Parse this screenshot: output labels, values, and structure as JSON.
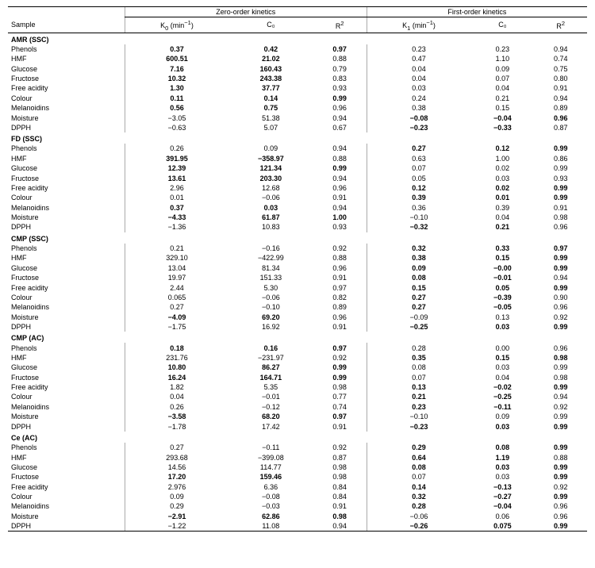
{
  "table": {
    "group1_label": "Zero-order kinetics",
    "group2_label": "First-order kinetics",
    "col_sample": "Sample",
    "col_k0": "K₀ (min⁻¹)",
    "col_c0_1": "C₀",
    "col_r2_1": "R²",
    "col_k1": "K₁ (min⁻¹)",
    "col_c0_2": "C₀",
    "col_r2_2": "R²",
    "sections": [
      {
        "section": "AMR (SSC)",
        "rows": [
          {
            "sample": "Phenols",
            "k0": "0.37",
            "c0_1": "0.42",
            "r2_1": "0.97",
            "k1": "0.23",
            "c0_2": "0.23",
            "r2_2": "0.94",
            "bold_k0": true,
            "bold_c0_1": true,
            "bold_r2_1": true
          },
          {
            "sample": "HMF",
            "k0": "600.51",
            "c0_1": "21.02",
            "r2_1": "0.88",
            "k1": "0.47",
            "c0_2": "1.10",
            "r2_2": "0.74",
            "bold_k0": true,
            "bold_c0_1": true
          },
          {
            "sample": "Glucose",
            "k0": "7.16",
            "c0_1": "160.43",
            "r2_1": "0.79",
            "k1": "0.04",
            "c0_2": "0.09",
            "r2_2": "0.75",
            "bold_k0": true,
            "bold_c0_1": true
          },
          {
            "sample": "Fructose",
            "k0": "10.32",
            "c0_1": "243.38",
            "r2_1": "0.83",
            "k1": "0.04",
            "c0_2": "0.07",
            "r2_2": "0.80",
            "bold_k0": true,
            "bold_c0_1": true
          },
          {
            "sample": "Free acidity",
            "k0": "1.30",
            "c0_1": "37.77",
            "r2_1": "0.93",
            "k1": "0.03",
            "c0_2": "0.04",
            "r2_2": "0.91",
            "bold_k0": true,
            "bold_c0_1": true
          },
          {
            "sample": "Colour",
            "k0": "0.11",
            "c0_1": "0.14",
            "r2_1": "0.99",
            "k1": "0.24",
            "c0_2": "0.21",
            "r2_2": "0.94",
            "bold_k0": true,
            "bold_c0_1": true,
            "bold_r2_1": true
          },
          {
            "sample": "Melanoidins",
            "k0": "0.56",
            "c0_1": "0.75",
            "r2_1": "0.96",
            "k1": "0.38",
            "c0_2": "0.15",
            "r2_2": "0.89",
            "bold_k0": true,
            "bold_c0_1": true
          },
          {
            "sample": "Moisture",
            "k0": "−3.05",
            "c0_1": "51.38",
            "r2_1": "0.94",
            "k1": "−0.08",
            "c0_2": "−0.04",
            "r2_2": "0.96",
            "bold_k1": true,
            "bold_c0_2": true,
            "bold_r2_2": true
          },
          {
            "sample": "DPPH",
            "k0": "−0.63",
            "c0_1": "5.07",
            "r2_1": "0.67",
            "k1": "−0.23",
            "c0_2": "−0.33",
            "r2_2": "0.87",
            "bold_k1": true,
            "bold_c0_2": true
          }
        ]
      },
      {
        "section": "FD (SSC)",
        "rows": [
          {
            "sample": "Phenols",
            "k0": "0.26",
            "c0_1": "0.09",
            "r2_1": "0.94",
            "k1": "0.27",
            "c0_2": "0.12",
            "r2_2": "0.99",
            "bold_k1": true,
            "bold_c0_2": true,
            "bold_r2_2": true
          },
          {
            "sample": "HMF",
            "k0": "391.95",
            "c0_1": "−358.97",
            "r2_1": "0.88",
            "k1": "0.63",
            "c0_2": "1.00",
            "r2_2": "0.86",
            "bold_k0": true,
            "bold_c0_1": true
          },
          {
            "sample": "Glucose",
            "k0": "12.39",
            "c0_1": "121.34",
            "r2_1": "0.99",
            "k1": "0.07",
            "c0_2": "0.02",
            "r2_2": "0.99",
            "bold_k0": true,
            "bold_c0_1": true,
            "bold_r2_1": true
          },
          {
            "sample": "Fructose",
            "k0": "13.61",
            "c0_1": "203.30",
            "r2_1": "0.94",
            "k1": "0.05",
            "c0_2": "0.03",
            "r2_2": "0.93",
            "bold_k0": true,
            "bold_c0_1": true
          },
          {
            "sample": "Free acidity",
            "k0": "2.96",
            "c0_1": "12.68",
            "r2_1": "0.96",
            "k1": "0.12",
            "c0_2": "0.02",
            "r2_2": "0.99",
            "bold_k1": true,
            "bold_c0_2": true,
            "bold_r2_2": true
          },
          {
            "sample": "Colour",
            "k0": "0.01",
            "c0_1": "−0.06",
            "r2_1": "0.91",
            "k1": "0.39",
            "c0_2": "0.01",
            "r2_2": "0.99",
            "bold_k1": true,
            "bold_c0_2": true,
            "bold_r2_2": true
          },
          {
            "sample": "Melanoidins",
            "k0": "0.37",
            "c0_1": "0.03",
            "r2_1": "0.94",
            "k1": "0.36",
            "c0_2": "0.39",
            "r2_2": "0.91",
            "bold_k0": true,
            "bold_c0_1": true
          },
          {
            "sample": "Moisture",
            "k0": "−4.33",
            "c0_1": "61.87",
            "r2_1": "1.00",
            "k1": "−0.10",
            "c0_2": "0.04",
            "r2_2": "0.98",
            "bold_k0": true,
            "bold_c0_1": true,
            "bold_r2_1": true
          },
          {
            "sample": "DPPH",
            "k0": "−1.36",
            "c0_1": "10.83",
            "r2_1": "0.93",
            "k1": "−0.32",
            "c0_2": "0.21",
            "r2_2": "0.96",
            "bold_k1": true,
            "bold_c0_2": true
          }
        ]
      },
      {
        "section": "CMP (SSC)",
        "rows": [
          {
            "sample": "Phenols",
            "k0": "0.21",
            "c0_1": "−0.16",
            "r2_1": "0.92",
            "k1": "0.32",
            "c0_2": "0.33",
            "r2_2": "0.97",
            "bold_k1": true,
            "bold_c0_2": true,
            "bold_r2_2": true
          },
          {
            "sample": "HMF",
            "k0": "329.10",
            "c0_1": "−422.99",
            "r2_1": "0.88",
            "k1": "0.38",
            "c0_2": "0.15",
            "r2_2": "0.99",
            "bold_k1": true,
            "bold_c0_2": true,
            "bold_r2_2": true
          },
          {
            "sample": "Glucose",
            "k0": "13.04",
            "c0_1": "81.34",
            "r2_1": "0.96",
            "k1": "0.09",
            "c0_2": "−0.00",
            "r2_2": "0.99",
            "bold_k1": true,
            "bold_c0_2": true,
            "bold_r2_2": true
          },
          {
            "sample": "Fructose",
            "k0": "19.97",
            "c0_1": "151.33",
            "r2_1": "0.91",
            "k1": "0.08",
            "c0_2": "−0.01",
            "r2_2": "0.94",
            "bold_k1": true,
            "bold_c0_2": true
          },
          {
            "sample": "Free acidity",
            "k0": "2.44",
            "c0_1": "5.30",
            "r2_1": "0.97",
            "k1": "0.15",
            "c0_2": "0.05",
            "r2_2": "0.99",
            "bold_k1": true,
            "bold_c0_2": true,
            "bold_r2_2": true
          },
          {
            "sample": "Colour",
            "k0": "0.065",
            "c0_1": "−0.06",
            "r2_1": "0.82",
            "k1": "0.27",
            "c0_2": "−0.39",
            "r2_2": "0.90",
            "bold_k1": true,
            "bold_c0_2": true
          },
          {
            "sample": "Melanoidins",
            "k0": "0.27",
            "c0_1": "−0.10",
            "r2_1": "0.89",
            "k1": "0.27",
            "c0_2": "−0.05",
            "r2_2": "0.96",
            "bold_k1": true,
            "bold_c0_2": true
          },
          {
            "sample": "Moisture",
            "k0": "−4.09",
            "c0_1": "69.20",
            "r2_1": "0.96",
            "k1": "−0.09",
            "c0_2": "0.13",
            "r2_2": "0.92",
            "bold_k0": true,
            "bold_c0_1": true
          },
          {
            "sample": "DPPH",
            "k0": "−1.75",
            "c0_1": "16.92",
            "r2_1": "0.91",
            "k1": "−0.25",
            "c0_2": "0.03",
            "r2_2": "0.99",
            "bold_k1": true,
            "bold_c0_2": true,
            "bold_r2_2": true
          }
        ]
      },
      {
        "section": "CMP (AC)",
        "rows": [
          {
            "sample": "Phenols",
            "k0": "0.18",
            "c0_1": "0.16",
            "r2_1": "0.97",
            "k1": "0.28",
            "c0_2": "0.00",
            "r2_2": "0.96",
            "bold_k0": true,
            "bold_c0_1": true,
            "bold_r2_1": true
          },
          {
            "sample": "HMF",
            "k0": "231.76",
            "c0_1": "−231.97",
            "r2_1": "0.92",
            "k1": "0.35",
            "c0_2": "0.15",
            "r2_2": "0.98",
            "bold_k1": true,
            "bold_c0_2": true,
            "bold_r2_2": true
          },
          {
            "sample": "Glucose",
            "k0": "10.80",
            "c0_1": "86.27",
            "r2_1": "0.99",
            "k1": "0.08",
            "c0_2": "0.03",
            "r2_2": "0.99",
            "bold_k0": true,
            "bold_c0_1": true,
            "bold_r2_1": true
          },
          {
            "sample": "Fructose",
            "k0": "16.24",
            "c0_1": "164.71",
            "r2_1": "0.99",
            "k1": "0.07",
            "c0_2": "0.04",
            "r2_2": "0.98",
            "bold_k0": true,
            "bold_c0_1": true,
            "bold_r2_1": true
          },
          {
            "sample": "Free acidity",
            "k0": "1.82",
            "c0_1": "5.35",
            "r2_1": "0.98",
            "k1": "0.13",
            "c0_2": "−0.02",
            "r2_2": "0.99",
            "bold_k1": true,
            "bold_c0_2": true,
            "bold_r2_2": true
          },
          {
            "sample": "Colour",
            "k0": "0.04",
            "c0_1": "−0.01",
            "r2_1": "0.77",
            "k1": "0.21",
            "c0_2": "−0.25",
            "r2_2": "0.94",
            "bold_k1": true,
            "bold_c0_2": true
          },
          {
            "sample": "Melanoidins",
            "k0": "0.26",
            "c0_1": "−0.12",
            "r2_1": "0.74",
            "k1": "0.23",
            "c0_2": "−0.11",
            "r2_2": "0.92",
            "bold_k1": true,
            "bold_c0_2": true
          },
          {
            "sample": "Moisture",
            "k0": "−3.58",
            "c0_1": "68.20",
            "r2_1": "0.97",
            "k1": "−0.10",
            "c0_2": "0.09",
            "r2_2": "0.99",
            "bold_k0": true,
            "bold_c0_1": true,
            "bold_r2_1": true
          },
          {
            "sample": "DPPH",
            "k0": "−1.78",
            "c0_1": "17.42",
            "r2_1": "0.91",
            "k1": "−0.23",
            "c0_2": "0.03",
            "r2_2": "0.99",
            "bold_k1": true,
            "bold_c0_2": true,
            "bold_r2_2": true
          }
        ]
      },
      {
        "section": "Ce (AC)",
        "rows": [
          {
            "sample": "Phenols",
            "k0": "0.27",
            "c0_1": "−0.11",
            "r2_1": "0.92",
            "k1": "0.29",
            "c0_2": "0.08",
            "r2_2": "0.99",
            "bold_k1": true,
            "bold_c0_2": true,
            "bold_r2_2": true
          },
          {
            "sample": "HMF",
            "k0": "293.68",
            "c0_1": "−399.08",
            "r2_1": "0.87",
            "k1": "0.64",
            "c0_2": "1.19",
            "r2_2": "0.88",
            "bold_k1": true,
            "bold_c0_2": true
          },
          {
            "sample": "Glucose",
            "k0": "14.56",
            "c0_1": "114.77",
            "r2_1": "0.98",
            "k1": "0.08",
            "c0_2": "0.03",
            "r2_2": "0.99",
            "bold_k1": true,
            "bold_c0_2": true,
            "bold_r2_2": true
          },
          {
            "sample": "Fructose",
            "k0": "17.20",
            "c0_1": "159.46",
            "r2_1": "0.98",
            "k1": "0.07",
            "c0_2": "0.03",
            "r2_2": "0.99",
            "bold_k0": true,
            "bold_c0_1": true,
            "bold_r2_2": true
          },
          {
            "sample": "Free acidity",
            "k0": "2.976",
            "c0_1": "6.36",
            "r2_1": "0.84",
            "k1": "0.14",
            "c0_2": "−0.13",
            "r2_2": "0.92",
            "bold_k1": true,
            "bold_c0_2": true
          },
          {
            "sample": "Colour",
            "k0": "0.09",
            "c0_1": "−0.08",
            "r2_1": "0.84",
            "k1": "0.32",
            "c0_2": "−0.27",
            "r2_2": "0.99",
            "bold_k1": true,
            "bold_c0_2": true,
            "bold_r2_2": true
          },
          {
            "sample": "Melanoidins",
            "k0": "0.29",
            "c0_1": "−0.03",
            "r2_1": "0.91",
            "k1": "0.28",
            "c0_2": "−0.04",
            "r2_2": "0.96",
            "bold_k1": true,
            "bold_c0_2": true
          },
          {
            "sample": "Moisture",
            "k0": "−2.91",
            "c0_1": "62.86",
            "r2_1": "0.98",
            "k1": "−0.06",
            "c0_2": "0.06",
            "r2_2": "0.96",
            "bold_k0": true,
            "bold_c0_1": true,
            "bold_r2_1": true
          },
          {
            "sample": "DPPH",
            "k0": "−1.22",
            "c0_1": "11.08",
            "r2_1": "0.94",
            "k1": "−0.26",
            "c0_2": "0.075",
            "r2_2": "0.99",
            "bold_k1": true,
            "bold_c0_2": true,
            "bold_r2_2": true
          }
        ]
      }
    ]
  }
}
